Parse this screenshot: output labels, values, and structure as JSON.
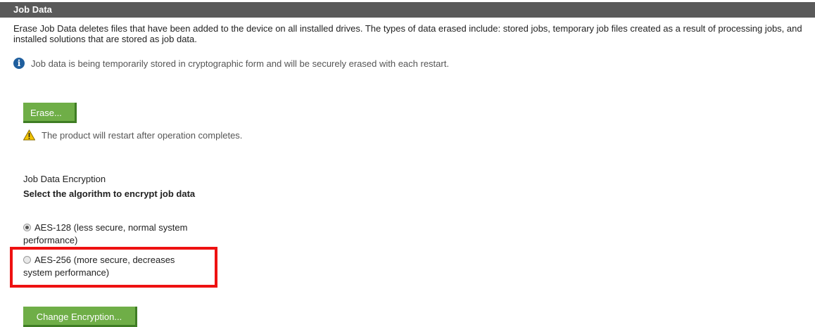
{
  "header": {
    "title": "Job Data"
  },
  "description": "Erase Job Data deletes files that have been added to the device on all installed drives. The types of data erased include: stored jobs, temporary job files created as a result of processing jobs, and installed solutions that are stored as job data.",
  "info": {
    "icon": "info-icon",
    "text": "Job data is being temporarily stored in cryptographic form and will be securely erased with each restart."
  },
  "erase_button": {
    "label": "Erase..."
  },
  "warning": {
    "icon": "warning-icon",
    "text": "The product will restart after operation completes."
  },
  "encryption": {
    "section_title": "Job Data Encryption",
    "select_label": "Select the algorithm to encrypt job data",
    "options": [
      {
        "label": "AES-128 (less secure, normal system performance)",
        "selected": true
      },
      {
        "label": "AES-256 (more secure, decreases system performance)",
        "selected": false
      }
    ],
    "highlight_color": "#ee1111",
    "change_button": {
      "label": "Change Encryption..."
    }
  },
  "colors": {
    "header_bg": "#5a5a5a",
    "button_bg": "#6fae47",
    "info_icon": "#1f5f9e",
    "warning_icon": "#f2c400"
  }
}
